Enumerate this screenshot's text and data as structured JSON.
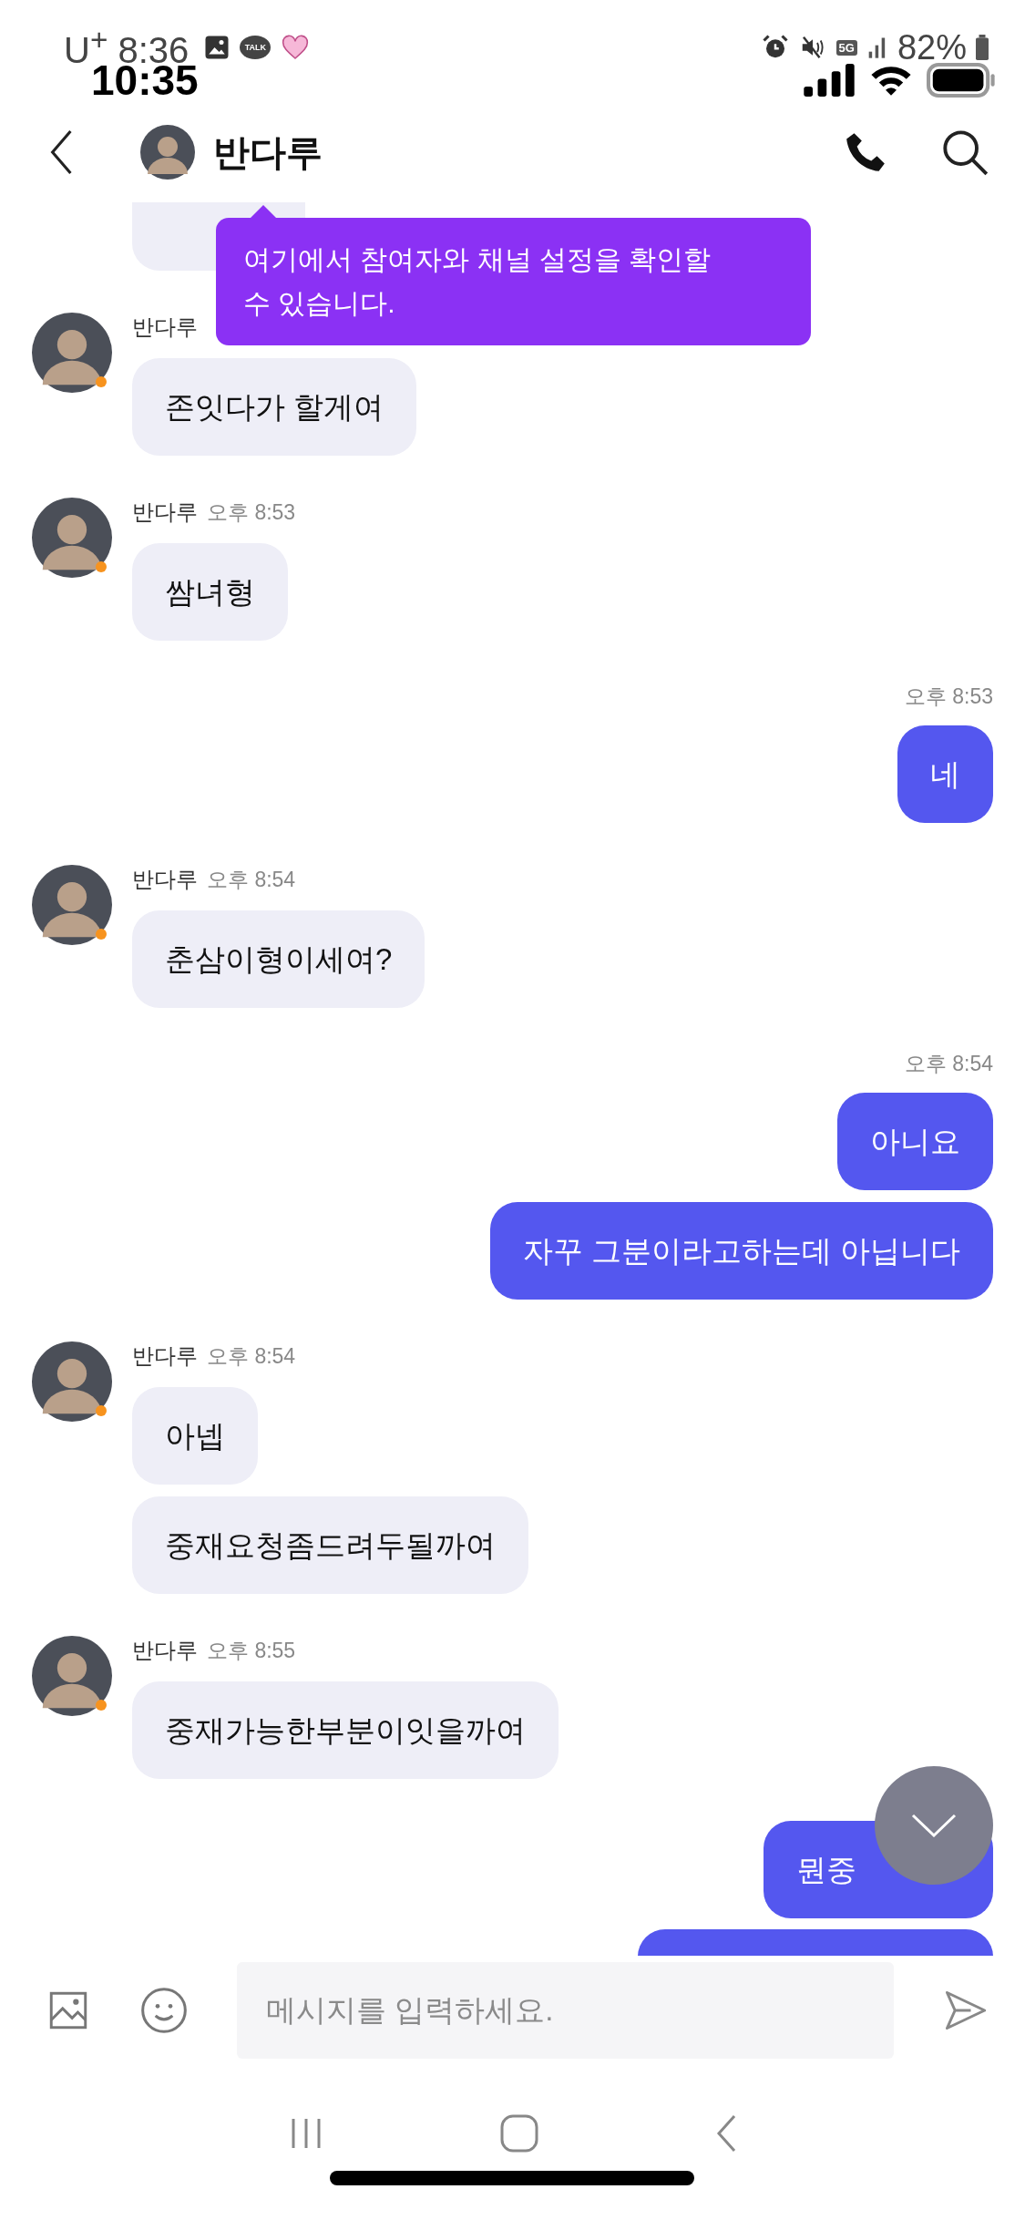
{
  "android_status": {
    "carrier_time": "U$^{+}$ 8:36",
    "talk_badge": "TALK",
    "network": "5G",
    "battery": "82%"
  },
  "ios_status": {
    "time": "10:35"
  },
  "header": {
    "title": "반다루"
  },
  "tooltip": {
    "text": "여기에서 참여자와 채널 설정을 확인할 수 있습니다."
  },
  "messages": [
    {
      "kind": "clipped_received"
    },
    {
      "kind": "received",
      "sender": "반다루",
      "bubbles": [
        "존잇다가 할게여"
      ]
    },
    {
      "kind": "received",
      "sender": "반다루",
      "time": "오후 8:53",
      "bubbles": [
        "쌈녀형"
      ]
    },
    {
      "kind": "sent",
      "time": "오후 8:53",
      "bubbles": [
        "네"
      ]
    },
    {
      "kind": "received",
      "sender": "반다루",
      "time": "오후 8:54",
      "bubbles": [
        "춘삼이형이세여?"
      ]
    },
    {
      "kind": "sent",
      "time": "오후 8:54",
      "bubbles": [
        "아니요",
        "자꾸 그분이라고하는데 아닙니다"
      ]
    },
    {
      "kind": "received",
      "sender": "반다루",
      "time": "오후 8:54",
      "bubbles": [
        "아넵",
        "중재요청좀드려두될까여"
      ]
    },
    {
      "kind": "received",
      "sender": "반다루",
      "time": "오후 8:55",
      "bubbles": [
        "중재가능한부분이잇을까여"
      ]
    },
    {
      "kind": "sent",
      "bubbles": [
        "뭔중"
      ]
    },
    {
      "kind": "clipped_sent"
    }
  ],
  "composer": {
    "placeholder": "메시지를 입력하세요."
  }
}
